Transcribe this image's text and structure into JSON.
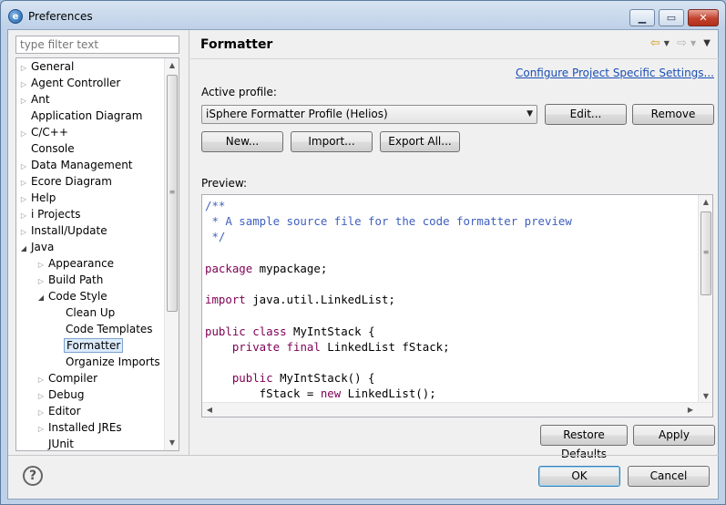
{
  "window": {
    "title": "Preferences",
    "app_icon": "eclipse-app-icon"
  },
  "left": {
    "filter_placeholder": "type filter text",
    "tree": [
      {
        "label": "General",
        "expander": "collapsed",
        "level": 0
      },
      {
        "label": "Agent Controller",
        "expander": "collapsed",
        "level": 0
      },
      {
        "label": "Ant",
        "expander": "collapsed",
        "level": 0
      },
      {
        "label": "Application Diagram",
        "expander": "none",
        "level": 0
      },
      {
        "label": "C/C++",
        "expander": "collapsed",
        "level": 0
      },
      {
        "label": "Console",
        "expander": "none",
        "level": 0
      },
      {
        "label": "Data Management",
        "expander": "collapsed",
        "level": 0
      },
      {
        "label": "Ecore Diagram",
        "expander": "collapsed",
        "level": 0
      },
      {
        "label": "Help",
        "expander": "collapsed",
        "level": 0
      },
      {
        "label": "i Projects",
        "expander": "collapsed",
        "level": 0
      },
      {
        "label": "Install/Update",
        "expander": "collapsed",
        "level": 0
      },
      {
        "label": "Java",
        "expander": "expanded",
        "level": 0
      },
      {
        "label": "Appearance",
        "expander": "collapsed",
        "level": 1
      },
      {
        "label": "Build Path",
        "expander": "collapsed",
        "level": 1
      },
      {
        "label": "Code Style",
        "expander": "expanded",
        "level": 1
      },
      {
        "label": "Clean Up",
        "expander": "none",
        "level": 2
      },
      {
        "label": "Code Templates",
        "expander": "none",
        "level": 2
      },
      {
        "label": "Formatter",
        "expander": "none",
        "level": 2,
        "selected": true
      },
      {
        "label": "Organize Imports",
        "expander": "none",
        "level": 2
      },
      {
        "label": "Compiler",
        "expander": "collapsed",
        "level": 1
      },
      {
        "label": "Debug",
        "expander": "collapsed",
        "level": 1
      },
      {
        "label": "Editor",
        "expander": "collapsed",
        "level": 1
      },
      {
        "label": "Installed JREs",
        "expander": "collapsed",
        "level": 1
      },
      {
        "label": "JUnit",
        "expander": "none",
        "level": 1
      }
    ]
  },
  "page": {
    "title": "Formatter",
    "link": "Configure Project Specific Settings...",
    "active_profile_label": "Active profile:",
    "active_profile_value": "iSphere Formatter Profile (Helios)",
    "buttons": {
      "edit": "Edit...",
      "remove": "Remove",
      "new": "New...",
      "import": "Import...",
      "export_all": "Export All...",
      "restore_defaults": "Restore Defaults",
      "apply": "Apply"
    },
    "preview_label": "Preview:",
    "code_lines": [
      "/**",
      " * A sample source file for the code formatter preview",
      " */",
      "",
      "package mypackage;",
      "",
      "import java.util.LinkedList;",
      "",
      "public class MyIntStack {",
      "    private final LinkedList fStack;",
      "",
      "    public MyIntStack() {",
      "        fStack = new LinkedList();"
    ]
  },
  "footer": {
    "ok": "OK",
    "cancel": "Cancel"
  }
}
